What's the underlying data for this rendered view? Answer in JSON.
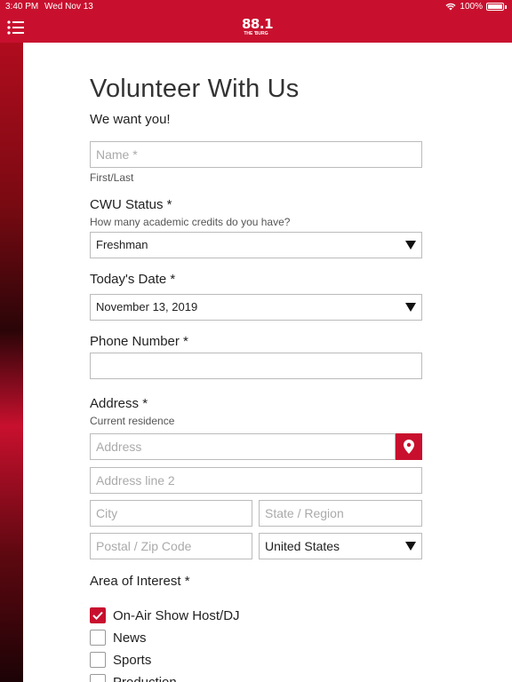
{
  "status": {
    "time": "3:40 PM",
    "date": "Wed Nov 13",
    "battery": "100%"
  },
  "app": {
    "logo_big": "88.1",
    "logo_small": "THE 'BURG"
  },
  "form": {
    "title": "Volunteer With Us",
    "subtitle": "We want you!",
    "name": {
      "placeholder": "Name *",
      "hint": "First/Last"
    },
    "cwu_status": {
      "label": "CWU Status *",
      "hint": "How many academic credits do you have?",
      "value": "Freshman"
    },
    "todays_date": {
      "label": "Today's Date *",
      "value": "November 13, 2019"
    },
    "phone": {
      "label": "Phone Number *",
      "value": ""
    },
    "address": {
      "label": "Address *",
      "hint": "Current residence",
      "line1_placeholder": "Address",
      "line2_placeholder": "Address line 2",
      "city_placeholder": "City",
      "state_placeholder": "State / Region",
      "zip_placeholder": "Postal / Zip Code",
      "country": "United States"
    },
    "interest": {
      "label": "Area of Interest *",
      "options": [
        {
          "label": "On-Air Show Host/DJ",
          "checked": true
        },
        {
          "label": "News",
          "checked": false
        },
        {
          "label": "Sports",
          "checked": false
        },
        {
          "label": "Production",
          "checked": false
        }
      ]
    }
  },
  "colors": {
    "brand": "#c8102e"
  },
  "icons": {
    "menu": "list-menu-icon",
    "map_pin": "map-pin-icon",
    "check": "check-icon"
  }
}
